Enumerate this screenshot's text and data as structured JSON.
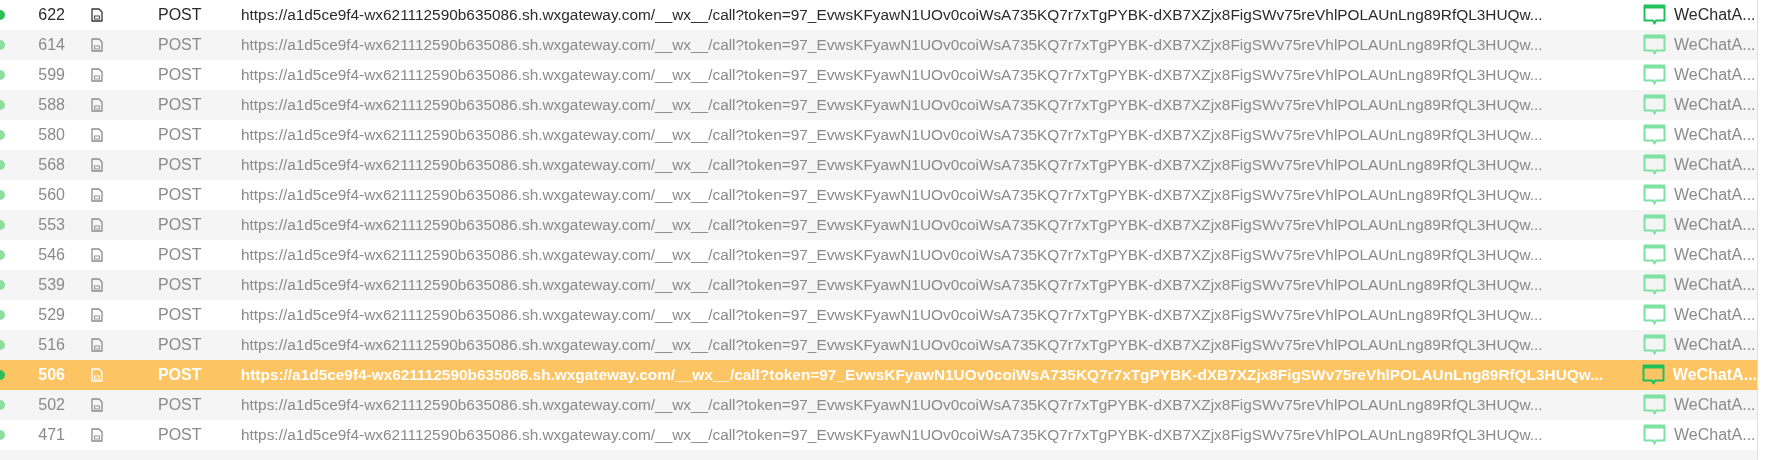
{
  "requests": [
    {
      "id": "622",
      "method": "POST",
      "url": "https://a1d5ce9f4-wx621112590b635086.sh.wxgateway.com/__wx__/call?token=97_EvwsKFyawN1UOv0coiWsA735KQ7r7xTgPYBK-dXB7XZjx8FigSWv75reVhlPOLAUnLng89RfQL3HUQw...",
      "client": "WeChatA...",
      "dimmed": false,
      "selected": false
    },
    {
      "id": "614",
      "method": "POST",
      "url": "https://a1d5ce9f4-wx621112590b635086.sh.wxgateway.com/__wx__/call?token=97_EvwsKFyawN1UOv0coiWsA735KQ7r7xTgPYBK-dXB7XZjx8FigSWv75reVhlPOLAUnLng89RfQL3HUQw...",
      "client": "WeChatA...",
      "dimmed": true,
      "selected": false
    },
    {
      "id": "599",
      "method": "POST",
      "url": "https://a1d5ce9f4-wx621112590b635086.sh.wxgateway.com/__wx__/call?token=97_EvwsKFyawN1UOv0coiWsA735KQ7r7xTgPYBK-dXB7XZjx8FigSWv75reVhlPOLAUnLng89RfQL3HUQw...",
      "client": "WeChatA...",
      "dimmed": true,
      "selected": false
    },
    {
      "id": "588",
      "method": "POST",
      "url": "https://a1d5ce9f4-wx621112590b635086.sh.wxgateway.com/__wx__/call?token=97_EvwsKFyawN1UOv0coiWsA735KQ7r7xTgPYBK-dXB7XZjx8FigSWv75reVhlPOLAUnLng89RfQL3HUQw...",
      "client": "WeChatA...",
      "dimmed": true,
      "selected": false
    },
    {
      "id": "580",
      "method": "POST",
      "url": "https://a1d5ce9f4-wx621112590b635086.sh.wxgateway.com/__wx__/call?token=97_EvwsKFyawN1UOv0coiWsA735KQ7r7xTgPYBK-dXB7XZjx8FigSWv75reVhlPOLAUnLng89RfQL3HUQw...",
      "client": "WeChatA...",
      "dimmed": true,
      "selected": false
    },
    {
      "id": "568",
      "method": "POST",
      "url": "https://a1d5ce9f4-wx621112590b635086.sh.wxgateway.com/__wx__/call?token=97_EvwsKFyawN1UOv0coiWsA735KQ7r7xTgPYBK-dXB7XZjx8FigSWv75reVhlPOLAUnLng89RfQL3HUQw...",
      "client": "WeChatA...",
      "dimmed": true,
      "selected": false
    },
    {
      "id": "560",
      "method": "POST",
      "url": "https://a1d5ce9f4-wx621112590b635086.sh.wxgateway.com/__wx__/call?token=97_EvwsKFyawN1UOv0coiWsA735KQ7r7xTgPYBK-dXB7XZjx8FigSWv75reVhlPOLAUnLng89RfQL3HUQw...",
      "client": "WeChatA...",
      "dimmed": true,
      "selected": false
    },
    {
      "id": "553",
      "method": "POST",
      "url": "https://a1d5ce9f4-wx621112590b635086.sh.wxgateway.com/__wx__/call?token=97_EvwsKFyawN1UOv0coiWsA735KQ7r7xTgPYBK-dXB7XZjx8FigSWv75reVhlPOLAUnLng89RfQL3HUQw...",
      "client": "WeChatA...",
      "dimmed": true,
      "selected": false
    },
    {
      "id": "546",
      "method": "POST",
      "url": "https://a1d5ce9f4-wx621112590b635086.sh.wxgateway.com/__wx__/call?token=97_EvwsKFyawN1UOv0coiWsA735KQ7r7xTgPYBK-dXB7XZjx8FigSWv75reVhlPOLAUnLng89RfQL3HUQw...",
      "client": "WeChatA...",
      "dimmed": true,
      "selected": false
    },
    {
      "id": "539",
      "method": "POST",
      "url": "https://a1d5ce9f4-wx621112590b635086.sh.wxgateway.com/__wx__/call?token=97_EvwsKFyawN1UOv0coiWsA735KQ7r7xTgPYBK-dXB7XZjx8FigSWv75reVhlPOLAUnLng89RfQL3HUQw...",
      "client": "WeChatA...",
      "dimmed": true,
      "selected": false
    },
    {
      "id": "529",
      "method": "POST",
      "url": "https://a1d5ce9f4-wx621112590b635086.sh.wxgateway.com/__wx__/call?token=97_EvwsKFyawN1UOv0coiWsA735KQ7r7xTgPYBK-dXB7XZjx8FigSWv75reVhlPOLAUnLng89RfQL3HUQw...",
      "client": "WeChatA...",
      "dimmed": true,
      "selected": false
    },
    {
      "id": "516",
      "method": "POST",
      "url": "https://a1d5ce9f4-wx621112590b635086.sh.wxgateway.com/__wx__/call?token=97_EvwsKFyawN1UOv0coiWsA735KQ7r7xTgPYBK-dXB7XZjx8FigSWv75reVhlPOLAUnLng89RfQL3HUQw...",
      "client": "WeChatA...",
      "dimmed": true,
      "selected": false
    },
    {
      "id": "506",
      "method": "POST",
      "url": "https://a1d5ce9f4-wx621112590b635086.sh.wxgateway.com/__wx__/call?token=97_EvwsKFyawN1UOv0coiWsA735KQ7r7xTgPYBK-dXB7XZjx8FigSWv75reVhlPOLAUnLng89RfQL3HUQw...",
      "client": "WeChatA...",
      "dimmed": false,
      "selected": true
    },
    {
      "id": "502",
      "method": "POST",
      "url": "https://a1d5ce9f4-wx621112590b635086.sh.wxgateway.com/__wx__/call?token=97_EvwsKFyawN1UOv0coiWsA735KQ7r7xTgPYBK-dXB7XZjx8FigSWv75reVhlPOLAUnLng89RfQL3HUQw...",
      "client": "WeChatA...",
      "dimmed": true,
      "selected": false
    },
    {
      "id": "471",
      "method": "POST",
      "url": "https://a1d5ce9f4-wx621112590b635086.sh.wxgateway.com/__wx__/call?token=97_EvwsKFyawN1UOv0coiWsA735KQ7r7xTgPYBK-dXB7XZjx8FigSWv75reVhlPOLAUnLng89RfQL3HUQw...",
      "client": "WeChatA...",
      "dimmed": true,
      "selected": false
    }
  ]
}
